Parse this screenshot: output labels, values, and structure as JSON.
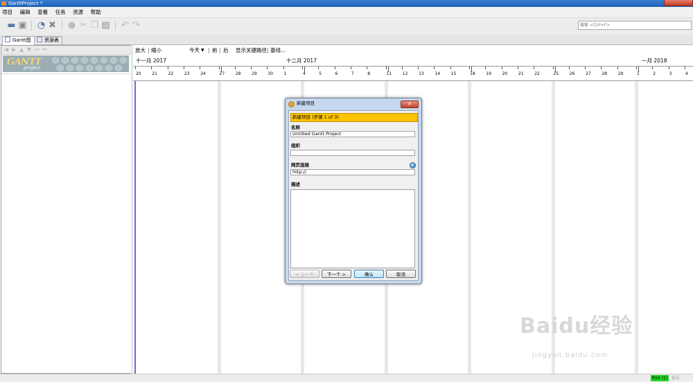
{
  "window": {
    "title": "GanttProject *"
  },
  "menu": [
    "项目",
    "编辑",
    "查看",
    "任务",
    "资源",
    "帮助"
  ],
  "toolbar_icons": [
    "open-icon",
    "save-icon",
    "properties-icon",
    "delete-icon",
    "info-icon",
    "cut-icon",
    "copy-icon",
    "paste-icon",
    "undo-icon",
    "redo-icon"
  ],
  "search": {
    "placeholder": "搜索 <Ctrl+F>"
  },
  "tabs": [
    {
      "label": "Gantt图",
      "active": true
    },
    {
      "label": "资源表",
      "active": false
    }
  ],
  "logo": {
    "text": "GANTT",
    "sub": "project"
  },
  "chart": {
    "zoom_in": "放大",
    "zoom_out": "缩小",
    "today": "今天",
    "prev": "前",
    "next": "后",
    "critical_path": "显示关键路径",
    "baseline": "基线...",
    "months": [
      "十一月 2017",
      "十二月 2017",
      "一月 2018"
    ],
    "days": [
      "20",
      "21",
      "22",
      "23",
      "24",
      "27",
      "28",
      "29",
      "30",
      "1",
      "4",
      "5",
      "6",
      "7",
      "8",
      "11",
      "12",
      "13",
      "14",
      "15",
      "18",
      "19",
      "20",
      "21",
      "22",
      "25",
      "26",
      "27",
      "28",
      "29",
      "1",
      "2",
      "3",
      "4"
    ]
  },
  "dialog": {
    "title": "新建项目",
    "step": "新建项目 (步骤 1 of 3)",
    "name_label": "名称",
    "name_value": "Untitled Gantt Project",
    "org_label": "组织",
    "org_value": "",
    "web_label": "网页连接",
    "web_value": "http://",
    "desc_label": "描述",
    "btn_prev": "< 上一个",
    "btn_next": "下一个 >",
    "btn_ok": "确认",
    "btn_cancel": "取消"
  },
  "status": {
    "rss": "RSS (1)",
    "error": "报告"
  },
  "watermark": {
    "main": "Baidu经验",
    "sub": "jingyan.baidu.com"
  }
}
